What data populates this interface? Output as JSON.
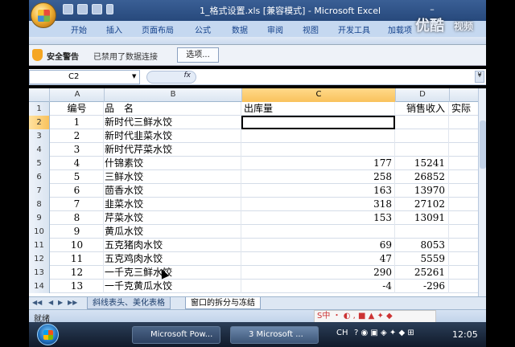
{
  "window": {
    "title": "1_格式设置.xls [兼容模式] - Microsoft Excel",
    "minimize_label": "–",
    "close_label": "✕"
  },
  "ribbon": {
    "tabs": [
      "开始",
      "插入",
      "页面布局",
      "公式",
      "数据",
      "审阅",
      "视图",
      "开发工具",
      "加载项"
    ]
  },
  "security_bar": {
    "label": "安全警告",
    "message": "已禁用了数据连接",
    "options_button": "选项..."
  },
  "formula_bar": {
    "name_box": "C2",
    "fx": "fx",
    "expand": "¥",
    "value": ""
  },
  "columns": [
    "A",
    "B",
    "C",
    "D"
  ],
  "selected_column": "C",
  "selected_row": 2,
  "header_row": {
    "row": "1",
    "a": "编号",
    "b": "品　名",
    "c": "出库量",
    "d": "销售收入",
    "e": "实际"
  },
  "rows": [
    {
      "row": "2",
      "a": "1",
      "b": "新时代三鲜水饺",
      "c": "",
      "d": ""
    },
    {
      "row": "3",
      "a": "2",
      "b": "新时代韭菜水饺",
      "c": "",
      "d": ""
    },
    {
      "row": "4",
      "a": "3",
      "b": "新时代芹菜水饺",
      "c": "",
      "d": ""
    },
    {
      "row": "5",
      "a": "4",
      "b": "什锦素饺",
      "c": "177",
      "d": "15241"
    },
    {
      "row": "6",
      "a": "5",
      "b": "三鲜水饺",
      "c": "258",
      "d": "26852"
    },
    {
      "row": "7",
      "a": "6",
      "b": "茴香水饺",
      "c": "163",
      "d": "13970"
    },
    {
      "row": "8",
      "a": "7",
      "b": "韭菜水饺",
      "c": "318",
      "d": "27102"
    },
    {
      "row": "9",
      "a": "8",
      "b": "芹菜水饺",
      "c": "153",
      "d": "13091"
    },
    {
      "row": "10",
      "a": "9",
      "b": "黄瓜水饺",
      "c": "",
      "d": ""
    },
    {
      "row": "11",
      "a": "10",
      "b": "五克猪肉水饺",
      "c": "69",
      "d": "8053"
    },
    {
      "row": "12",
      "a": "11",
      "b": "五克鸡肉水饺",
      "c": "47",
      "d": "5559"
    },
    {
      "row": "13",
      "a": "12",
      "b": "一千克三鲜水饺",
      "c": "290",
      "d": "25261"
    },
    {
      "row": "14",
      "a": "13",
      "b": "一千克黄瓜水饺",
      "c": "-4",
      "d": "-296"
    }
  ],
  "sheet_tabs": [
    "斜线表头、美化表格",
    "窗口的拆分与冻结"
  ],
  "active_sheet": "窗口的拆分与冻结",
  "status": "就绪",
  "ime_text": "S中 ・ ◐ , ■ ▲ ✦ ◆",
  "taskbar": {
    "items": [
      "Microsoft Pow...",
      "3 Microsoft ..."
    ],
    "tray": "CH",
    "clock": "12:05"
  },
  "watermark": {
    "brand": "优酷",
    "suffix": "视频"
  },
  "colors": {
    "title_bar": "#2f548a",
    "ribbon": "#c5d8f0",
    "selected_header": "#f9c25c",
    "taskbar": "#1b2a40"
  }
}
